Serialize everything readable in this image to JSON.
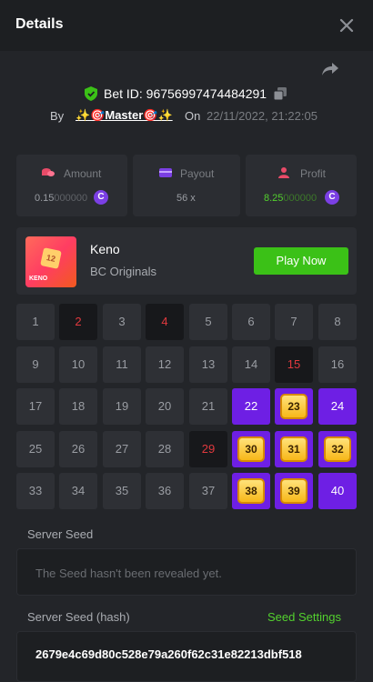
{
  "header": {
    "title": "Details"
  },
  "bet": {
    "id_text": "Bet ID: 96756997474484291",
    "by_label": "By",
    "username": "✨🎯Master🎯✨",
    "on_label": "On",
    "datetime": "22/11/2022, 21:22:05"
  },
  "stats": [
    {
      "label": "Amount",
      "value_main": "0.15",
      "value_dim": "000000",
      "icon": "coin-stack-icon",
      "color": "#e84b68"
    },
    {
      "label": "Payout",
      "value": "56 x",
      "icon": "wallet-icon",
      "color": "#7b3fe4"
    },
    {
      "label": "Profit",
      "value_main": "8.25",
      "value_dim": "000000",
      "icon": "user-profit-icon",
      "color": "#e84b68"
    }
  ],
  "coin_symbol": "C",
  "game": {
    "name": "Keno",
    "provider": "BC Originals",
    "thumb_number": "12",
    "thumb_logo": "KENO",
    "play_label": "Play Now"
  },
  "grid": [
    {
      "n": "1",
      "s": "n"
    },
    {
      "n": "2",
      "s": "m"
    },
    {
      "n": "3",
      "s": "n"
    },
    {
      "n": "4",
      "s": "m"
    },
    {
      "n": "5",
      "s": "n"
    },
    {
      "n": "6",
      "s": "n"
    },
    {
      "n": "7",
      "s": "n"
    },
    {
      "n": "8",
      "s": "n"
    },
    {
      "n": "9",
      "s": "n"
    },
    {
      "n": "10",
      "s": "n"
    },
    {
      "n": "11",
      "s": "n"
    },
    {
      "n": "12",
      "s": "n"
    },
    {
      "n": "13",
      "s": "n"
    },
    {
      "n": "14",
      "s": "n"
    },
    {
      "n": "15",
      "s": "m"
    },
    {
      "n": "16",
      "s": "n"
    },
    {
      "n": "17",
      "s": "n"
    },
    {
      "n": "18",
      "s": "n"
    },
    {
      "n": "19",
      "s": "n"
    },
    {
      "n": "20",
      "s": "n"
    },
    {
      "n": "21",
      "s": "n"
    },
    {
      "n": "22",
      "s": "p"
    },
    {
      "n": "23",
      "s": "h"
    },
    {
      "n": "24",
      "s": "p"
    },
    {
      "n": "25",
      "s": "n"
    },
    {
      "n": "26",
      "s": "n"
    },
    {
      "n": "27",
      "s": "n"
    },
    {
      "n": "28",
      "s": "n"
    },
    {
      "n": "29",
      "s": "m"
    },
    {
      "n": "30",
      "s": "h"
    },
    {
      "n": "31",
      "s": "h"
    },
    {
      "n": "32",
      "s": "h"
    },
    {
      "n": "33",
      "s": "n"
    },
    {
      "n": "34",
      "s": "n"
    },
    {
      "n": "35",
      "s": "n"
    },
    {
      "n": "36",
      "s": "n"
    },
    {
      "n": "37",
      "s": "n"
    },
    {
      "n": "38",
      "s": "h"
    },
    {
      "n": "39",
      "s": "h"
    },
    {
      "n": "40",
      "s": "p"
    }
  ],
  "seeds": {
    "server_seed_label": "Server Seed",
    "server_seed_placeholder": "The Seed hasn't been revealed yet.",
    "server_seed_hash_label": "Server Seed (hash)",
    "seed_settings_label": "Seed Settings",
    "server_seed_hash": "2679e4c69d80c528e79a260f62c31e82213dbf518"
  }
}
